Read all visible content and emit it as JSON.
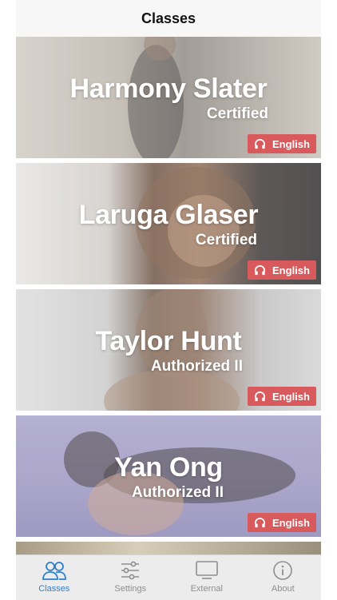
{
  "header": {
    "title": "Classes"
  },
  "teachers": [
    {
      "name": "Harmony Slater",
      "level": "Certified",
      "language": "English"
    },
    {
      "name": "Laruga Glaser",
      "level": "Certified",
      "language": "English"
    },
    {
      "name": "Taylor Hunt",
      "level": "Authorized II",
      "language": "English"
    },
    {
      "name": "Yan Ong",
      "level": "Authorized II",
      "language": "English"
    }
  ],
  "tabbar": {
    "tabs": [
      {
        "label": "Classes",
        "icon": "people-icon",
        "active": true
      },
      {
        "label": "Settings",
        "icon": "sliders-icon",
        "active": false
      },
      {
        "label": "External",
        "icon": "monitor-icon",
        "active": false
      },
      {
        "label": "About",
        "icon": "info-icon",
        "active": false
      }
    ]
  },
  "colors": {
    "accent": "#2f7fd0",
    "language_badge": "#d95a5c",
    "tab_inactive": "#8e8e8e"
  }
}
